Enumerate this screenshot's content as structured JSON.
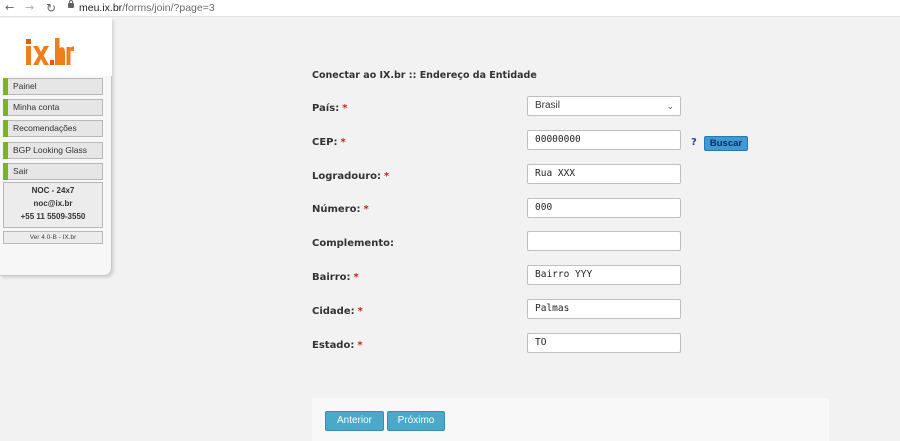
{
  "browser": {
    "url_host": "meu.ix.br",
    "url_path": "/forms/join/?page=3"
  },
  "sidebar": {
    "logo_text": "ix.br",
    "menu": [
      {
        "label": "Painel"
      },
      {
        "label": "Minha conta"
      },
      {
        "label": "Recomendações"
      },
      {
        "label": "BGP Looking Glass"
      },
      {
        "label": "Sair"
      }
    ],
    "noc": {
      "title": "NOC - 24x7",
      "email": "noc@ix.br",
      "phone": "+55 11 5509-3550"
    },
    "version": "Ver 4.0-B - IX.br"
  },
  "form": {
    "title": "Conectar ao IX.br :: Endereço da Entidade",
    "required_mark": "*",
    "pais": {
      "label": "País:",
      "value": "Brasil"
    },
    "cep": {
      "label": "CEP:",
      "value": "00000000",
      "help": "?",
      "buscar": "Buscar"
    },
    "logradouro": {
      "label": "Logradouro:",
      "value": "Rua XXX"
    },
    "numero": {
      "label": "Número:",
      "value": "000"
    },
    "complemento": {
      "label": "Complemento:",
      "value": ""
    },
    "bairro": {
      "label": "Bairro:",
      "value": "Bairro YYY"
    },
    "cidade": {
      "label": "Cidade:",
      "value": "Palmas"
    },
    "estado": {
      "label": "Estado:",
      "value": "TO"
    }
  },
  "actions": {
    "anterior": "Anterior",
    "proximo": "Próximo"
  },
  "colors": {
    "accent_green": "#7ab51d",
    "button_blue": "#4aa8c8",
    "required_red": "#cc1f1f",
    "logo_orange": "#f07e1b"
  }
}
